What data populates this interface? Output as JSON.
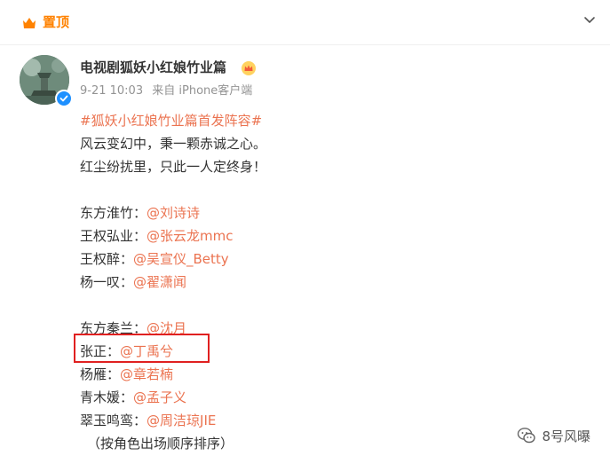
{
  "header": {
    "pin_label": "置顶"
  },
  "post": {
    "account_name": "电视剧狐妖小红娘竹业篇",
    "timestamp": "9-21 10:03",
    "source": "来自 iPhone客户端",
    "hashtag": "#狐妖小红娘竹业篇首发阵容#",
    "intro_lines": [
      "风云变幻中，秉一颗赤诚之心。",
      "红尘纷扰里，只此一人定终身！"
    ],
    "cast_group_1": [
      {
        "role": "东方淮竹：",
        "actor": "@刘诗诗"
      },
      {
        "role": "王权弘业：",
        "actor": "@张云龙mmc"
      },
      {
        "role": "王权醉：",
        "actor": "@吴宣仪_Betty"
      },
      {
        "role": "杨一叹：",
        "actor": "@翟潇闻"
      }
    ],
    "cast_group_2": [
      {
        "role": "东方秦兰：",
        "actor": "@沈月"
      },
      {
        "role": "张正：",
        "actor": "@丁禹兮"
      },
      {
        "role": "杨雁：",
        "actor": "@章若楠"
      },
      {
        "role": "青木媛：",
        "actor": "@孟子义"
      },
      {
        "role": "翠玉鸣鸾：",
        "actor": "@周洁琼JIE"
      }
    ],
    "footnote": "（按角色出场顺序排序）"
  },
  "watermark": {
    "text": "8号风曝"
  },
  "colors": {
    "accent": "#ff8200",
    "link": "#eb7350",
    "highlight": "#e02020",
    "verified": "#1e90ff"
  },
  "icons": {
    "pin": "pin-badge-icon",
    "chevron": "chevron-down-icon",
    "crown": "crown-icon",
    "verified": "verified-icon",
    "watermark": "wechat-icon"
  }
}
